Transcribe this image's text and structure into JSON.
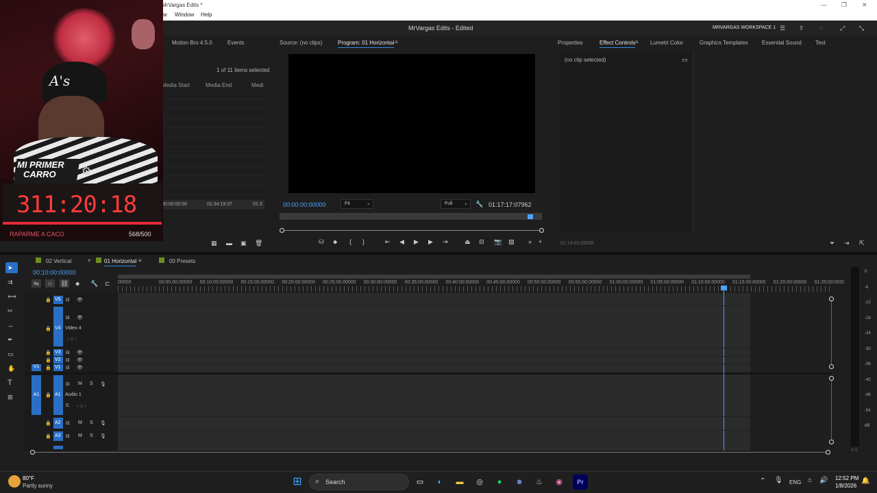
{
  "app": {
    "window_title": "MrVargas Edits *",
    "menu": [
      "w",
      "Window",
      "Help"
    ],
    "doc_title": "MrVargas Edits - Edited",
    "workspace": "MRVARGAS WORKSPACE 1"
  },
  "project_panel": {
    "tabs": [
      "Motion Bro 4.5.0",
      "Events"
    ],
    "selection_text": "1 of 11 items selected",
    "columns": [
      "Media Start",
      "Media End",
      "Medi"
    ],
    "row": {
      "start": "00:00:00:00",
      "end": "01:34:19:37",
      "partial": "01:3"
    }
  },
  "program_monitor": {
    "source_tab": "Source: (no clips)",
    "program_tab": "Program: 01 Horizontal",
    "timecode": "00:00:00:00000",
    "fit": "Fit",
    "quality": "Full",
    "duration": "01:17:17:07962"
  },
  "effects_panel": {
    "tabs": [
      "Properties",
      "Effect Controls",
      "Lumetri Color",
      "Graphics Templates",
      "Essential Sound",
      "Text"
    ],
    "no_clip": "(no clip selected)",
    "footer_time": "01:14:03:08838"
  },
  "timeline": {
    "tabs": [
      "02 Vertical",
      "01 Horizontal",
      "00 Presets"
    ],
    "timecode": "00:10:00:00000",
    "ruler": [
      "00000",
      "00:05:00:00000",
      "00:10:00:00000",
      "00:15:00:00000",
      "00:20:00:00000",
      "00:25:00:00000",
      "00:30:00:00000",
      "00:35:00:00000",
      "00:40:00:00000",
      "00:45:00:00000",
      "00:50:00:00000",
      "00:55:00:00000",
      "01:00:00:00000",
      "01:05:00:00000",
      "01:10:00:00000",
      "01:15:00:00000",
      "01:20:00:00000",
      "01:25:00:00000"
    ],
    "video_tracks": [
      {
        "name": "V5"
      },
      {
        "name": "V4",
        "label": "Video 4"
      },
      {
        "name": "V3"
      },
      {
        "name": "V2"
      },
      {
        "name": "V1",
        "patch": "V1"
      }
    ],
    "audio_tracks": [
      {
        "name": "A1",
        "patch": "A1",
        "label": "Audio 1",
        "volume": "0."
      },
      {
        "name": "A2"
      },
      {
        "name": "A3"
      },
      {
        "name": "A4"
      }
    ],
    "track_buttons": {
      "mute": "M",
      "solo": "S"
    }
  },
  "meter": {
    "labels": [
      "0",
      "-6",
      "-12",
      "-18",
      "-24",
      "-30",
      "-36",
      "-42",
      "-48",
      "-54",
      "dB"
    ],
    "footer": "S S"
  },
  "webcam_overlay": {
    "badge_line1": "MI PRIMER",
    "badge_line2": "CARRO",
    "counter": "311:20:18",
    "footer_left": "RAPARME A CACO",
    "footer_right": "568/500",
    "cap_logo": "A's"
  },
  "taskbar": {
    "weather_temp": "80°F",
    "weather_desc": "Partly sunny",
    "search_placeholder": "Search",
    "lang": "ENG",
    "time": "12:52 PM",
    "date": "1/8/2026",
    "app_icons": [
      "start-icon",
      "search-icon",
      "file-manager-icon",
      "edge-icon",
      "folder-icon",
      "chrome-icon",
      "spotify-icon",
      "discord-icon",
      "steam-icon",
      "browser-icon",
      "premiere-icon"
    ]
  },
  "colors": {
    "accent": "#2d8ceb",
    "timecode": "#4aa3ff",
    "counter_red": "#ff3b3b",
    "bg": "#1e1e1e"
  }
}
